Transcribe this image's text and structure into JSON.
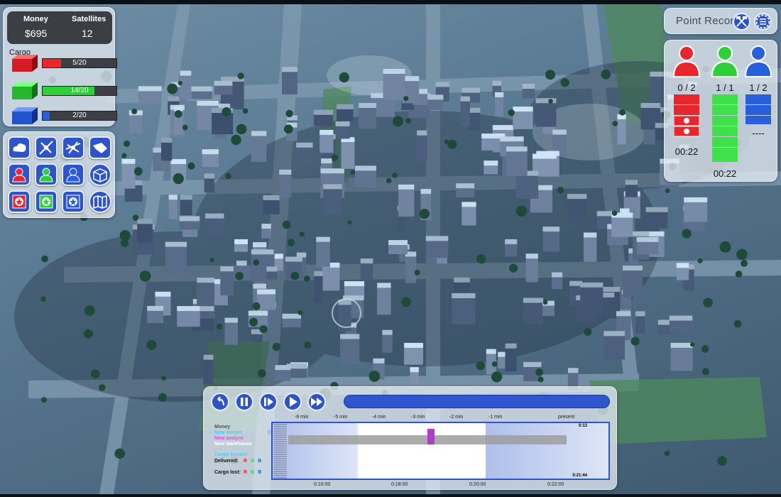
{
  "stats": {
    "money_label": "Money",
    "money_value": "$695",
    "satellites_label": "Satellites",
    "satellites_value": "12",
    "cargo_label": "Cargo",
    "cargo": [
      {
        "color": "red",
        "hex": "#e8262d",
        "text": "5/20",
        "fraction": 0.25
      },
      {
        "color": "green",
        "hex": "#2fcf3a",
        "text": "14/20",
        "fraction": 0.7
      },
      {
        "color": "blue",
        "hex": "#2a5fdc",
        "text": "2/20",
        "fraction": 0.1
      }
    ]
  },
  "tools": {
    "row1": [
      "cloud-icon",
      "satellite-icon",
      "drone-icon",
      "uav-icon"
    ],
    "row2": [
      "red-agent-icon",
      "green-agent-icon",
      "blue-agent-icon",
      "cargo-box-icon"
    ],
    "row3": [
      "red-mission-icon",
      "green-mission-icon",
      "blue-mission-icon",
      "map-icon"
    ]
  },
  "recon": {
    "title": "Point Recon",
    "buttons": [
      "flag-icon",
      "menu-icon"
    ]
  },
  "agents": [
    {
      "color": "#e8262d",
      "count": "0 / 2",
      "time": "00:22"
    },
    {
      "color": "#2fcf3a",
      "count": "1 / 1",
      "time": "00:22"
    },
    {
      "color": "#2a5fdc",
      "count": "1 / 2",
      "time": "----"
    }
  ],
  "timeline": {
    "controls": [
      "rewind-icon",
      "pause-icon",
      "step-icon",
      "play-icon",
      "fast-forward-icon"
    ],
    "ticks": [
      "-6 min",
      "-5 min",
      "-4 min",
      "-3 min",
      "-2 min",
      "-1 min",
      "present"
    ],
    "legend": [
      {
        "text": "Money",
        "color": "#555555"
      },
      {
        "text": "New sensor",
        "color": "#3fd0ff"
      },
      {
        "text": "New analyst",
        "color": "#ff40ff"
      },
      {
        "text": "New warehouse",
        "color": "#ffffff"
      },
      {
        "text": "Cargo sensed",
        "color": "#3fd0ff"
      },
      {
        "text": "Delivered:",
        "color": "#111111"
      },
      {
        "text": "Cargo lost:",
        "color": "#111111"
      }
    ],
    "rgb": [
      "R",
      "G",
      "B"
    ],
    "rgb_colors": [
      "#e8262d",
      "#2fcf3a",
      "#2a5fdc"
    ],
    "chart_top_label": "0:13",
    "chart_bottom_label": "0:21:44",
    "bottom_ticks": [
      "0:16:00",
      "0:18:00",
      "0:20:00",
      "0:22:00"
    ]
  }
}
